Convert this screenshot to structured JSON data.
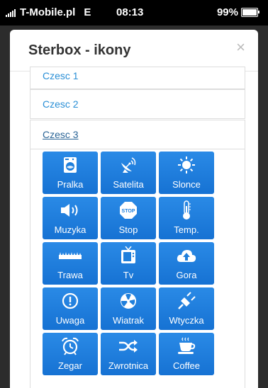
{
  "status_bar": {
    "carrier": "T-Mobile.pl",
    "network": "E",
    "time": "08:13",
    "battery": "99%"
  },
  "modal": {
    "title": "Sterbox - ikony",
    "close_label": "×"
  },
  "sections": [
    {
      "label": "Czesc 1"
    },
    {
      "label": "Czesc 2"
    },
    {
      "label": "Czesc 3"
    }
  ],
  "tiles": [
    {
      "label": "Pralka",
      "icon": "washing-machine-icon"
    },
    {
      "label": "Satelita",
      "icon": "satellite-dish-icon"
    },
    {
      "label": "Slonce",
      "icon": "sun-icon"
    },
    {
      "label": "Muzyka",
      "icon": "speaker-icon"
    },
    {
      "label": "Stop",
      "icon": "stop-sign-icon",
      "icon_text": "STOP"
    },
    {
      "label": "Temp.",
      "icon": "thermometer-icon"
    },
    {
      "label": "Trawa",
      "icon": "grass-icon"
    },
    {
      "label": "Tv",
      "icon": "tv-icon"
    },
    {
      "label": "Gora",
      "icon": "cloud-upload-icon"
    },
    {
      "label": "Uwaga",
      "icon": "warning-icon"
    },
    {
      "label": "Wiatrak",
      "icon": "fan-icon"
    },
    {
      "label": "Wtyczka",
      "icon": "plug-icon"
    },
    {
      "label": "Zegar",
      "icon": "alarm-clock-icon"
    },
    {
      "label": "Zwrotnica",
      "icon": "shuffle-icon"
    },
    {
      "label": "Coffee",
      "icon": "coffee-cup-icon"
    }
  ],
  "colors": {
    "tile_blue": "#1f7fdc",
    "link_blue": "#2a8fd6"
  }
}
